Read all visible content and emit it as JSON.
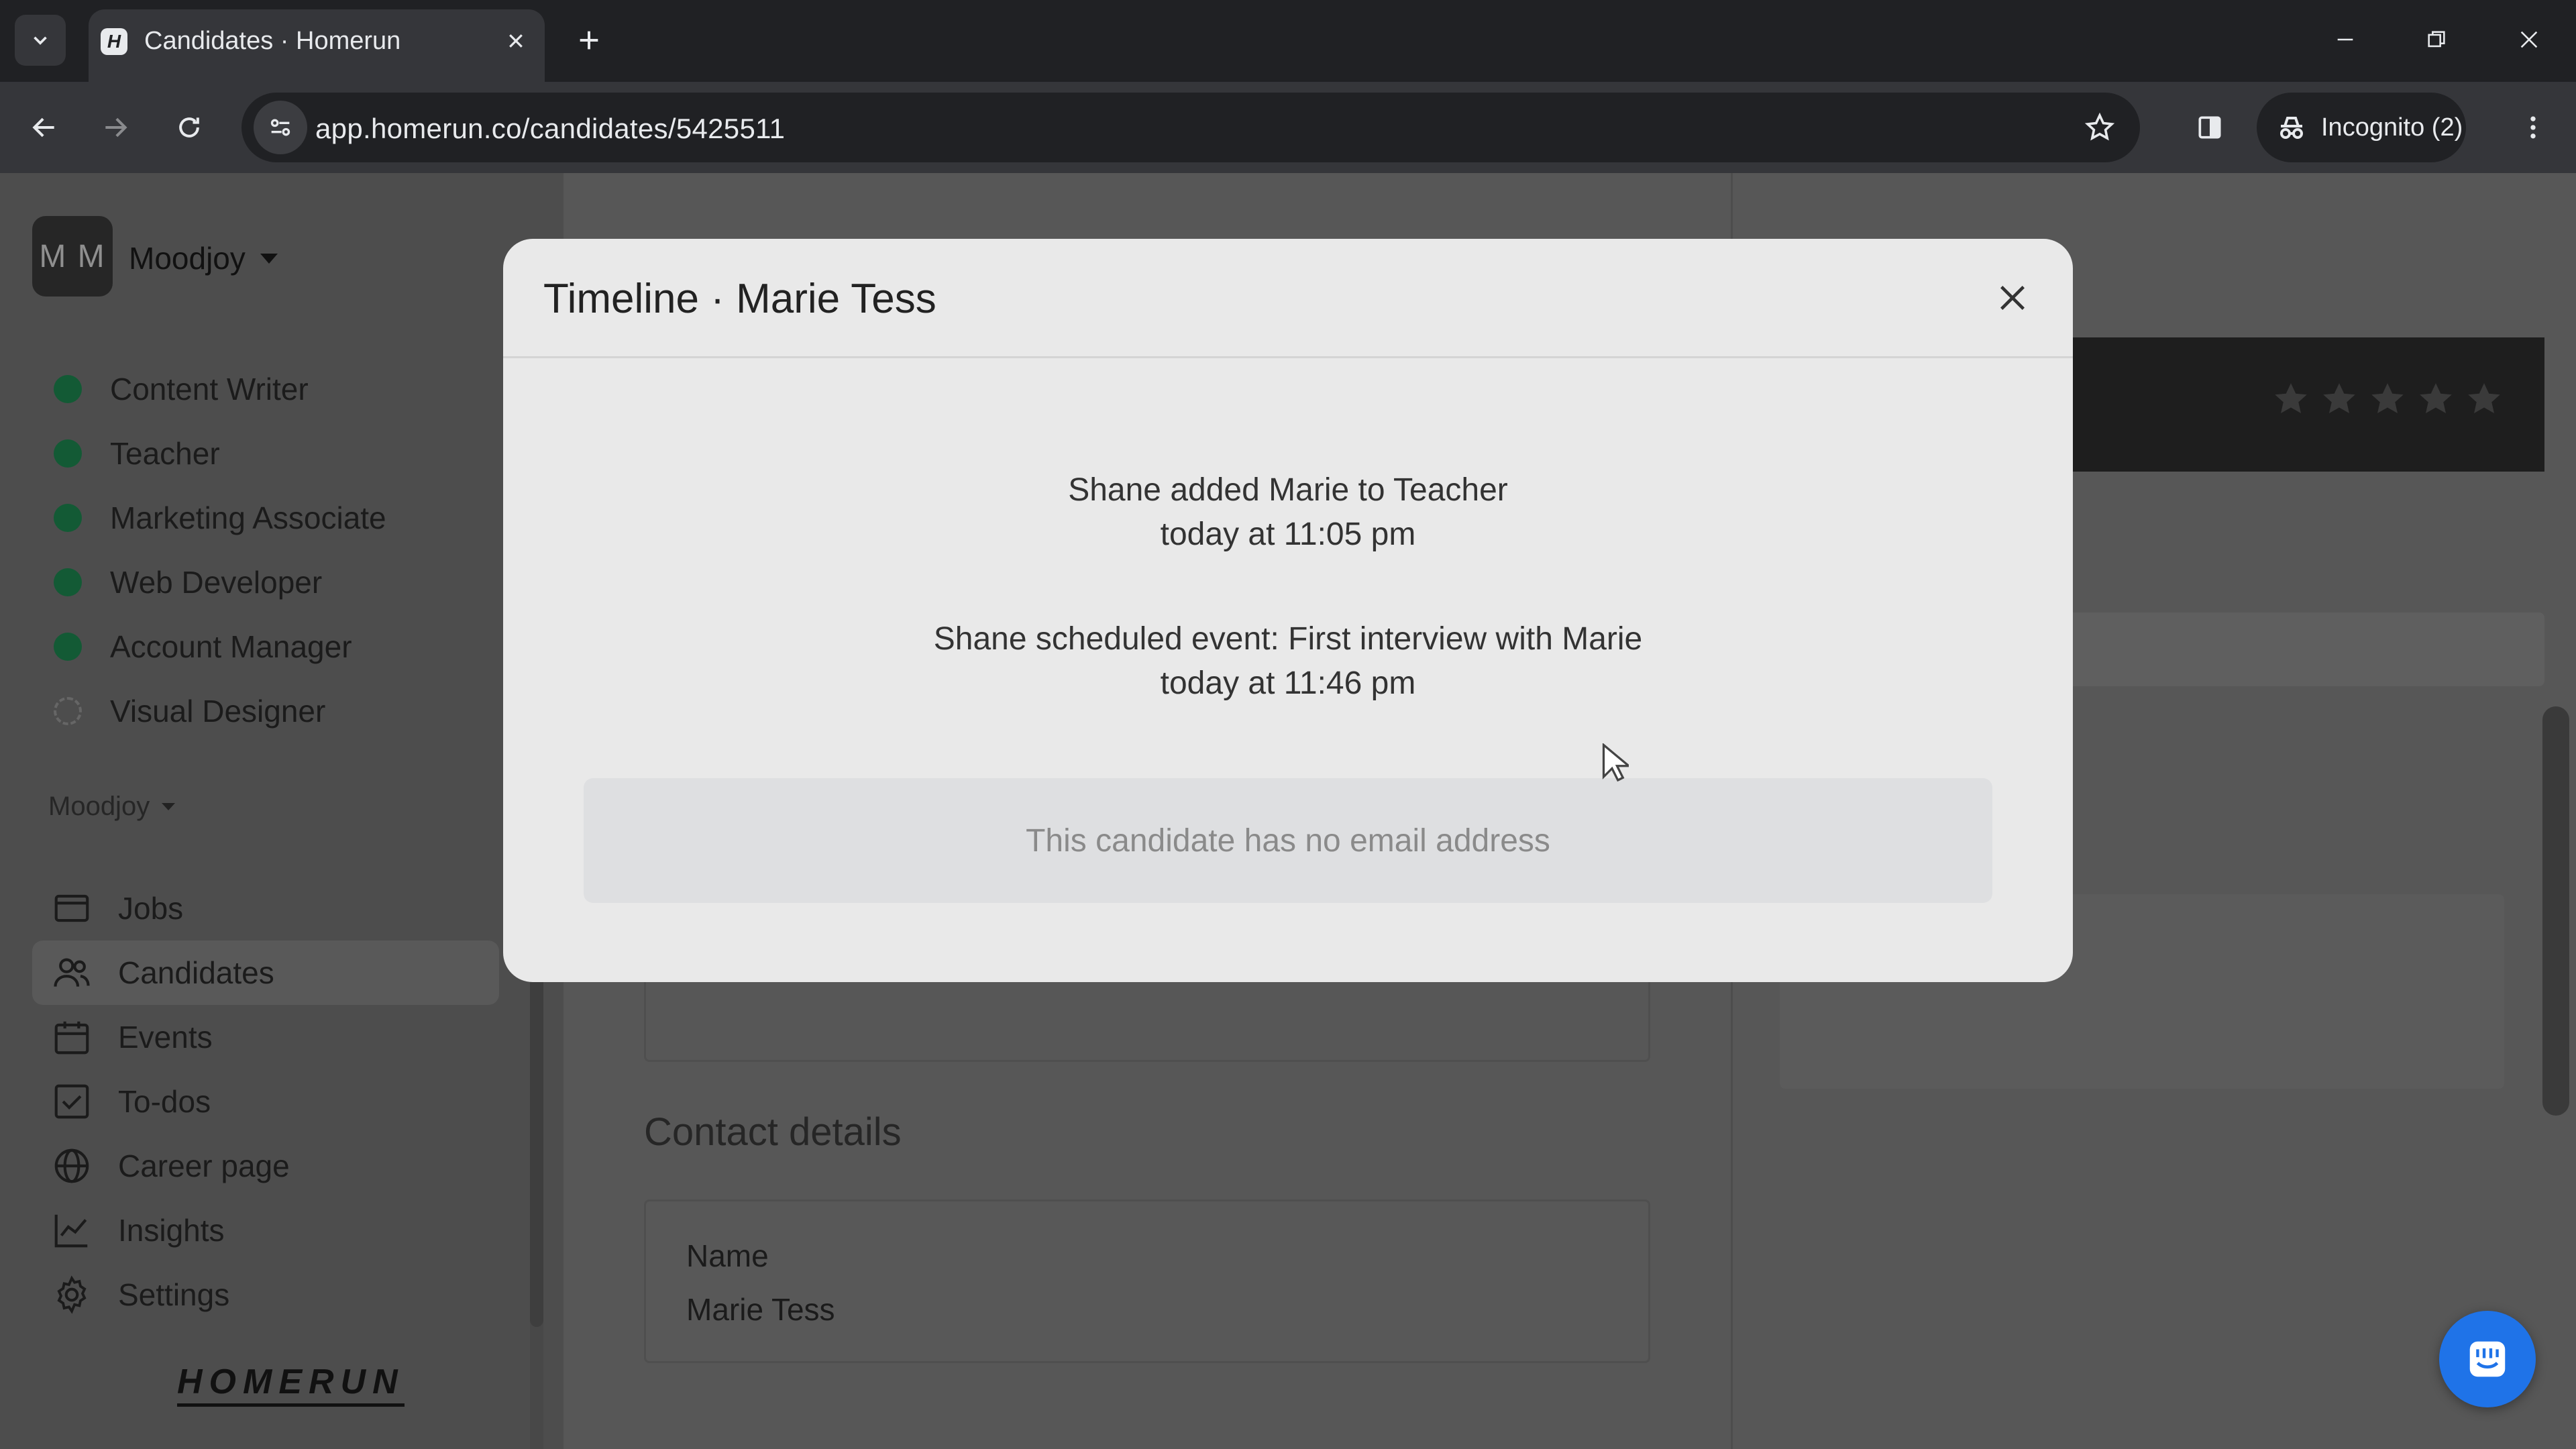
{
  "browser": {
    "tab_title": "Candidates · Homerun",
    "favicon_letter": "H",
    "url": "app.homerun.co/candidates/5425511",
    "incognito_label": "Incognito (2)"
  },
  "sidebar": {
    "org_initials": "M M",
    "org_name": "Moodjoy",
    "jobs": [
      {
        "label": "Content Writer",
        "status": "published"
      },
      {
        "label": "Teacher",
        "status": "published"
      },
      {
        "label": "Marketing Associate",
        "status": "published"
      },
      {
        "label": "Web Developer",
        "status": "published"
      },
      {
        "label": "Account Manager",
        "status": "published"
      },
      {
        "label": "Visual Designer",
        "status": "draft"
      }
    ],
    "section_label": "Moodjoy",
    "nav": [
      {
        "label": "Jobs",
        "icon": "briefcase-icon"
      },
      {
        "label": "Candidates",
        "icon": "people-icon",
        "active": true
      },
      {
        "label": "Events",
        "icon": "calendar-icon"
      },
      {
        "label": "To-dos",
        "icon": "checkbox-icon"
      },
      {
        "label": "Career page",
        "icon": "globe-icon"
      },
      {
        "label": "Insights",
        "icon": "chart-line-icon"
      },
      {
        "label": "Settings",
        "icon": "gear-icon"
      }
    ],
    "logo_text": "HOMERUN"
  },
  "main": {
    "contact_title": "Contact details",
    "name_label": "Name",
    "name_value": "Marie Tess"
  },
  "modal": {
    "title": "Timeline · Marie Tess",
    "events": [
      {
        "text": "Shane added Marie to Teacher",
        "time": "today at 11:05 pm"
      },
      {
        "text": "Shane scheduled event: First interview with Marie",
        "time": "today at 11:46 pm"
      }
    ],
    "notice": "This candidate has no email address"
  },
  "colors": {
    "published_dot": "#135a35",
    "chat_bubble": "#1f73e8"
  }
}
